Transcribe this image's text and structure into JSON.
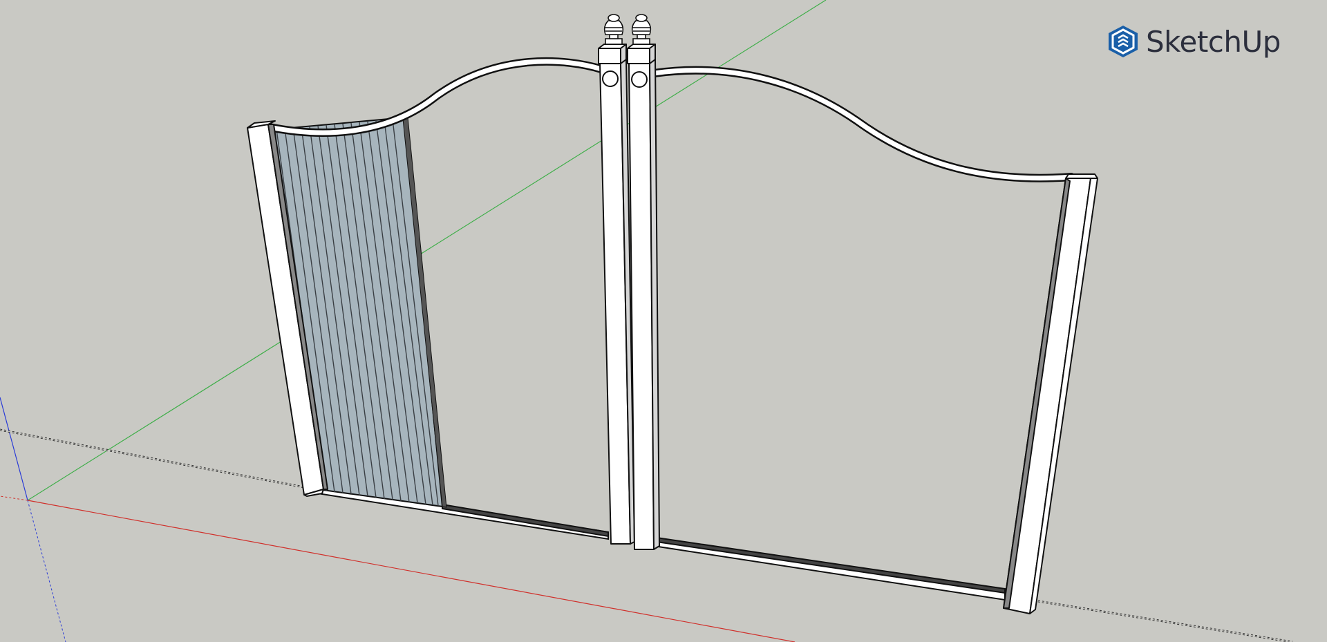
{
  "app": {
    "name": "SketchUp",
    "brand_color": "#1a5fa8"
  },
  "scene": {
    "background_color": "#c9c9c4",
    "axes": {
      "red_axis_color": "#d0302b",
      "green_axis_color": "#3fae49",
      "blue_axis_color": "#2a3bd6"
    },
    "model_colors": {
      "post_fill": "#ffffff",
      "edge_color": "#111111",
      "side_shade": "#d6d6d6",
      "panel_fill": "#a7b5bd"
    },
    "icons": [
      "sketchup-logo-icon"
    ]
  }
}
